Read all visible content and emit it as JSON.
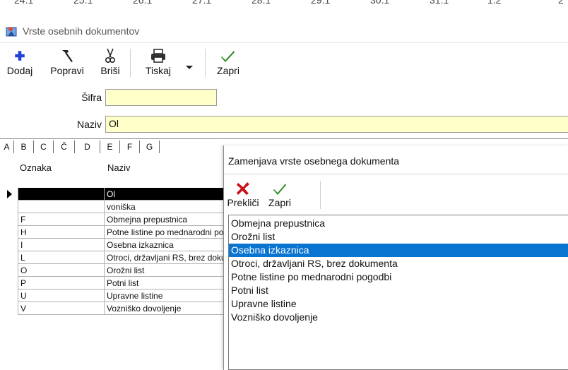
{
  "ruler": {
    "ticks": [
      "24.1",
      "25.1",
      "26.1",
      "27.1",
      "28.1",
      "29.1",
      "30.1",
      "31.1",
      "1.2",
      "2"
    ]
  },
  "window": {
    "title": "Vrste osebnih dokumentov"
  },
  "toolbar": {
    "add": "Dodaj",
    "edit": "Popravi",
    "delete": "Briši",
    "print": "Tiskaj",
    "close": "Zapri"
  },
  "form": {
    "code_label": "Šifra",
    "code_value": "",
    "name_label": "Naziv",
    "name_value": "Ol"
  },
  "letter_tabs": [
    "A",
    "B",
    "C",
    "Č",
    "D",
    "E",
    "F",
    "G"
  ],
  "grid": {
    "columns": [
      "Oznaka",
      "Naziv"
    ],
    "rows": [
      {
        "code": "",
        "name": "Ol"
      },
      {
        "code": "",
        "name": "voniška"
      },
      {
        "code": "F",
        "name": "Obmejna prepustnica"
      },
      {
        "code": "H",
        "name": "Potne listine po mednarodni pogodbi"
      },
      {
        "code": "I",
        "name": "Osebna izkaznica"
      },
      {
        "code": "L",
        "name": "Otroci, državljani RS, brez dokumenta"
      },
      {
        "code": "O",
        "name": "Orožni list"
      },
      {
        "code": "P",
        "name": "Potni list"
      },
      {
        "code": "U",
        "name": "Upravne listine"
      },
      {
        "code": "V",
        "name": "Vozniško dovoljenje"
      }
    ]
  },
  "dialog": {
    "title": "Zamenjava vrste osebnega dokumenta",
    "cancel": "Prekliči",
    "close": "Zapri",
    "selected_index": 2,
    "items": [
      "Obmejna prepustnica",
      "Orožni list",
      "Osebna izkaznica",
      "Otroci, državljani RS, brez dokumenta",
      "Potne listine po mednarodni pogodbi",
      "Potni list",
      "Upravne listine",
      "Vozniško dovoljenje"
    ]
  },
  "colors": {
    "field_bg": "#ffffc9",
    "selection": "#0a74d1",
    "selected_row": "#000000",
    "accent_green": "#2e8b22",
    "accent_blue": "#1f3fd6",
    "accent_red": "#c8101a"
  }
}
